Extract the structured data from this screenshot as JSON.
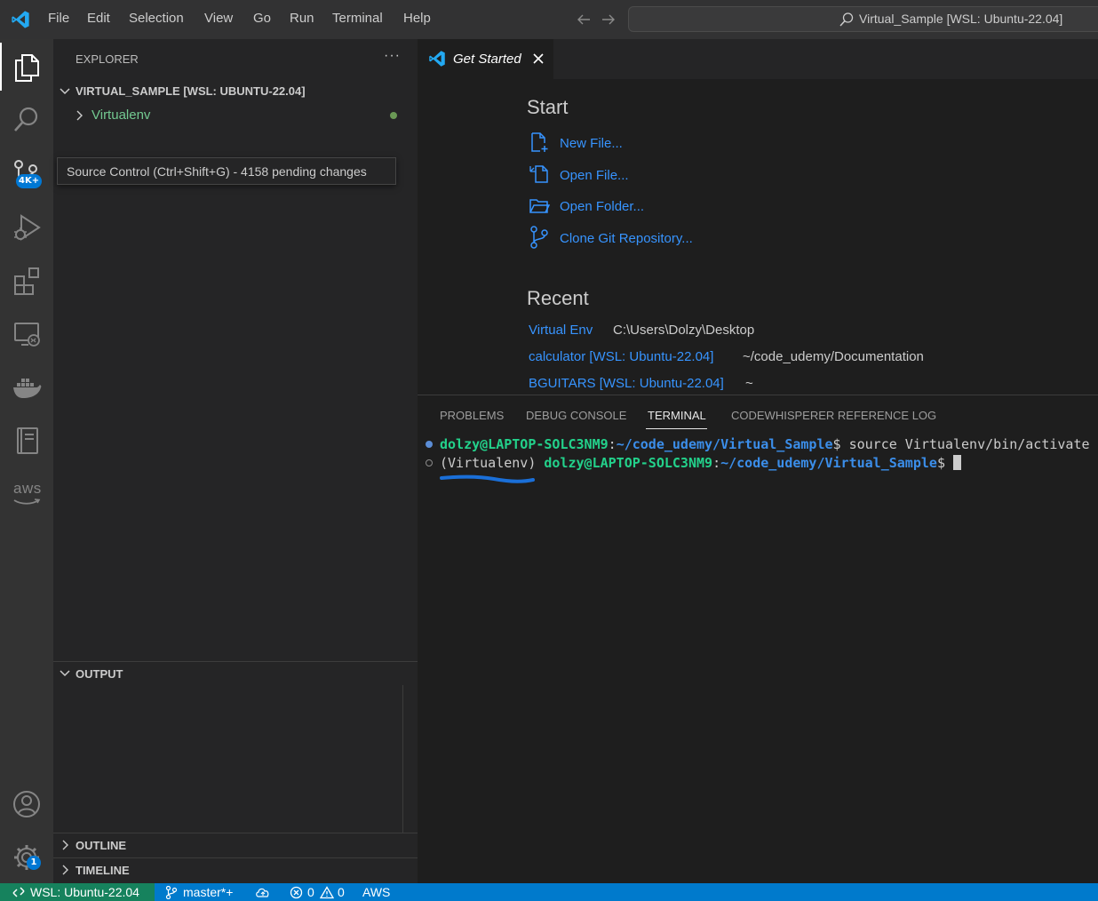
{
  "menu": [
    "File",
    "Edit",
    "Selection",
    "View",
    "Go",
    "Run",
    "Terminal",
    "Help"
  ],
  "command_center": {
    "text": "Virtual_Sample [WSL: Ubuntu-22.04]"
  },
  "activity_bar": {
    "source_control_badge": "4K+",
    "settings_badge": "1",
    "aws_label": "aws"
  },
  "sidebar": {
    "title": "EXPLORER",
    "more": "···",
    "workspace": "VIRTUAL_SAMPLE [WSL: UBUNTU-22.04]",
    "folder": "Virtualenv",
    "output_header": "OUTPUT",
    "outline_header": "OUTLINE",
    "timeline_header": "TIMELINE"
  },
  "tooltip": "Source Control (Ctrl+Shift+G) - 4158 pending changes",
  "tab": {
    "label": "Get Started"
  },
  "welcome": {
    "start_heading": "Start",
    "actions": [
      "New File...",
      "Open File...",
      "Open Folder...",
      "Clone Git Repository..."
    ],
    "recent_heading": "Recent",
    "recent": [
      {
        "name": "Virtual Env",
        "path": "C:\\Users\\Dolzy\\Desktop"
      },
      {
        "name": "calculator [WSL: Ubuntu-22.04]",
        "path": "~/code_udemy/Documentation"
      },
      {
        "name": "BGUITARS [WSL: Ubuntu-22.04]",
        "path": "~"
      }
    ]
  },
  "panel": {
    "tabs": [
      "PROBLEMS",
      "DEBUG CONSOLE",
      "TERMINAL",
      "CODEWHISPERER REFERENCE LOG"
    ],
    "active_tab": "TERMINAL",
    "terminal": {
      "line1": {
        "user": "dolzy@LAPTOP-SOLC3NM9",
        "sep": ":",
        "path": "~/code_udemy/Virtual_Sample",
        "prompt": "$",
        "command": " source Virtualenv/bin/activate"
      },
      "line2": {
        "env": "(Virtualenv) ",
        "user": "dolzy@LAPTOP-SOLC3NM9",
        "sep": ":",
        "path": "~/code_udemy/Virtual_Sample",
        "prompt": "$ "
      }
    }
  },
  "status_bar": {
    "remote": "WSL: Ubuntu-22.04",
    "branch": "master*+",
    "errors": "0",
    "warnings": "0",
    "aws": "AWS"
  },
  "colors": {
    "accent": "#007acc",
    "remote": "#16825d",
    "link": "#3794ff",
    "terminal_user": "#23d18b",
    "terminal_path": "#3b8eea"
  }
}
